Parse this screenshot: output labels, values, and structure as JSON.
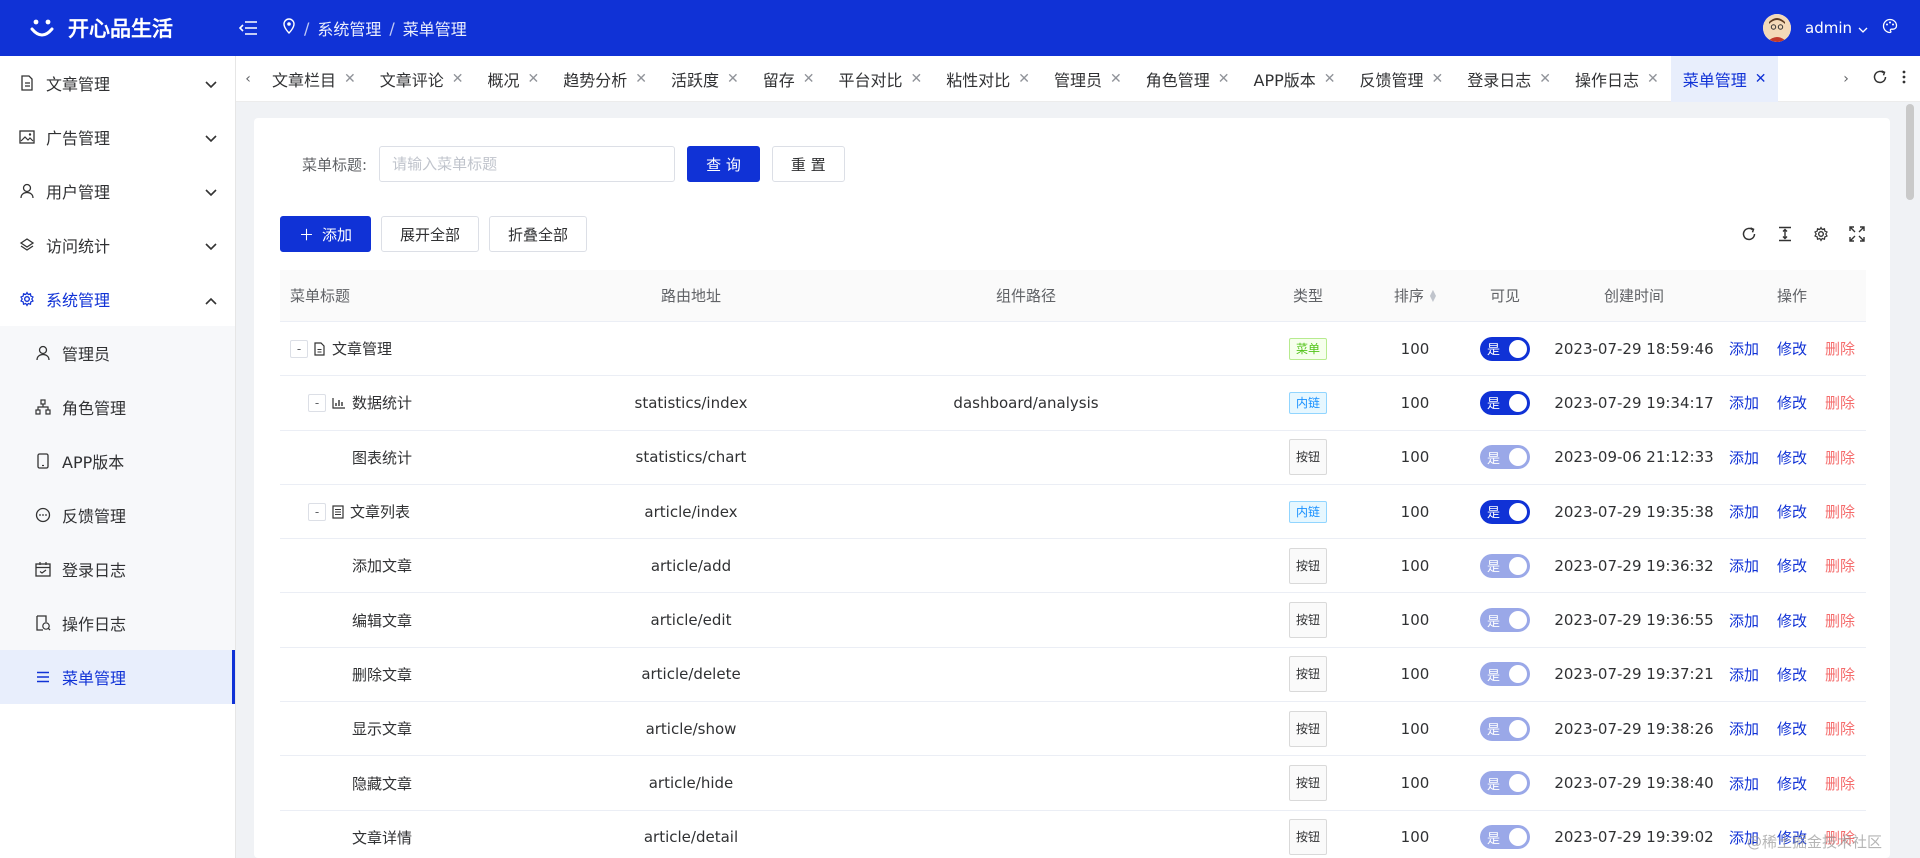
{
  "app": {
    "title": "开心品生活"
  },
  "breadcrumb": [
    "系统管理",
    "菜单管理"
  ],
  "user": {
    "name": "admin"
  },
  "sidebar": {
    "items": [
      {
        "label": "文章管理",
        "icon": "document-icon",
        "expanded": false
      },
      {
        "label": "广告管理",
        "icon": "image-icon",
        "expanded": false
      },
      {
        "label": "用户管理",
        "icon": "user-icon",
        "expanded": false
      },
      {
        "label": "访问统计",
        "icon": "stats-icon",
        "expanded": false
      },
      {
        "label": "系统管理",
        "icon": "gear-icon",
        "expanded": true
      }
    ],
    "sub_items": [
      {
        "label": "管理员",
        "icon": "user-icon"
      },
      {
        "label": "角色管理",
        "icon": "org-icon"
      },
      {
        "label": "APP版本",
        "icon": "phone-icon"
      },
      {
        "label": "反馈管理",
        "icon": "chat-icon"
      },
      {
        "label": "登录日志",
        "icon": "calendar-icon"
      },
      {
        "label": "操作日志",
        "icon": "log-icon"
      },
      {
        "label": "菜单管理",
        "icon": "menu-icon",
        "selected": true
      }
    ]
  },
  "tabs": [
    "文章栏目",
    "文章评论",
    "概况",
    "趋势分析",
    "活跃度",
    "留存",
    "平台对比",
    "粘性对比",
    "管理员",
    "角色管理",
    "APP版本",
    "反馈管理",
    "登录日志",
    "操作日志",
    "菜单管理"
  ],
  "active_tab": "菜单管理",
  "search": {
    "label": "菜单标题:",
    "placeholder": "请输入菜单标题",
    "query_button": "查 询",
    "reset_button": "重 置"
  },
  "toolbar": {
    "add": "添加",
    "expand_all": "展开全部",
    "collapse_all": "折叠全部"
  },
  "table": {
    "headers": {
      "title": "菜单标题",
      "route": "路由地址",
      "component": "组件路径",
      "type": "类型",
      "sort": "排序",
      "visible": "可见",
      "created": "创建时间",
      "ops": "操作"
    },
    "ops": {
      "add": "添加",
      "edit": "修改",
      "delete": "删除"
    },
    "switch_on_label": "是",
    "rows": [
      {
        "level": 0,
        "expander": "-",
        "icon": "document-icon",
        "title": "文章管理",
        "route": "",
        "component": "",
        "type": "菜单",
        "type_kind": "menu",
        "sort": "100",
        "visible_on": true,
        "created": "2023-07-29 18:59:46"
      },
      {
        "level": 1,
        "expander": "-",
        "icon": "chart-icon",
        "title": "数据统计",
        "route": "statistics/index",
        "component": "dashboard/analysis",
        "type": "内链",
        "type_kind": "link",
        "sort": "100",
        "visible_on": true,
        "created": "2023-07-29 19:34:17"
      },
      {
        "level": 2,
        "expander": "",
        "icon": "",
        "title": "图表统计",
        "route": "statistics/chart",
        "component": "",
        "type": "按钮",
        "type_kind": "btn",
        "sort": "100",
        "visible_on": false,
        "created": "2023-09-06 21:12:33"
      },
      {
        "level": 1,
        "expander": "-",
        "icon": "list-icon",
        "title": "文章列表",
        "route": "article/index",
        "component": "",
        "type": "内链",
        "type_kind": "link",
        "sort": "100",
        "visible_on": true,
        "created": "2023-07-29 19:35:38"
      },
      {
        "level": 2,
        "expander": "",
        "icon": "",
        "title": "添加文章",
        "route": "article/add",
        "component": "",
        "type": "按钮",
        "type_kind": "btn",
        "sort": "100",
        "visible_on": false,
        "created": "2023-07-29 19:36:32"
      },
      {
        "level": 2,
        "expander": "",
        "icon": "",
        "title": "编辑文章",
        "route": "article/edit",
        "component": "",
        "type": "按钮",
        "type_kind": "btn",
        "sort": "100",
        "visible_on": false,
        "created": "2023-07-29 19:36:55"
      },
      {
        "level": 2,
        "expander": "",
        "icon": "",
        "title": "删除文章",
        "route": "article/delete",
        "component": "",
        "type": "按钮",
        "type_kind": "btn",
        "sort": "100",
        "visible_on": false,
        "created": "2023-07-29 19:37:21"
      },
      {
        "level": 2,
        "expander": "",
        "icon": "",
        "title": "显示文章",
        "route": "article/show",
        "component": "",
        "type": "按钮",
        "type_kind": "btn",
        "sort": "100",
        "visible_on": false,
        "created": "2023-07-29 19:38:26"
      },
      {
        "level": 2,
        "expander": "",
        "icon": "",
        "title": "隐藏文章",
        "route": "article/hide",
        "component": "",
        "type": "按钮",
        "type_kind": "btn",
        "sort": "100",
        "visible_on": false,
        "created": "2023-07-29 19:38:40"
      },
      {
        "level": 2,
        "expander": "",
        "icon": "",
        "title": "文章详情",
        "route": "article/detail",
        "component": "",
        "type": "按钮",
        "type_kind": "btn",
        "sort": "100",
        "visible_on": false,
        "created": "2023-07-29 19:39:02"
      }
    ]
  },
  "watermark": "@稀土掘金技术社区",
  "colors": {
    "brand": "#1032d6",
    "danger": "#f56c6c"
  }
}
